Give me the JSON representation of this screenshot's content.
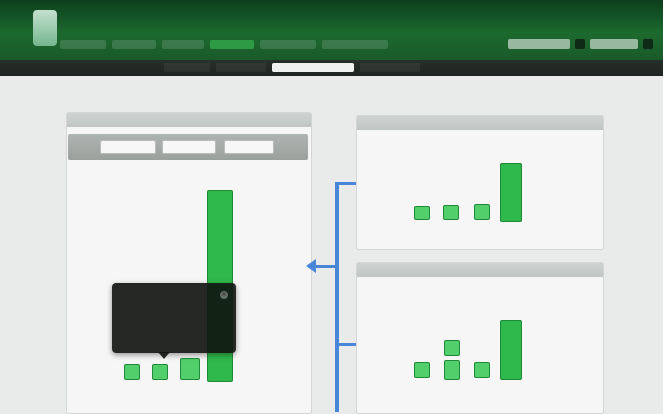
{
  "header": {
    "app_title": "",
    "nav_items": [
      "",
      "",
      "",
      "",
      "",
      ""
    ],
    "active_nav_index": 3,
    "tools": [
      "",
      "",
      ""
    ]
  },
  "subnav": {
    "tabs": [
      "",
      "",
      "",
      ""
    ],
    "active_index": 2
  },
  "left_panel": {
    "title": "",
    "filters": [
      "",
      "",
      ""
    ],
    "y_axis_labels": [
      "",
      "",
      "",
      ""
    ],
    "x_caption": ""
  },
  "tooltip": {
    "title": "",
    "left_value": "",
    "right_value": "",
    "close_icon": "close-icon"
  },
  "right_panel_top": {
    "title": "",
    "y_axis_labels": [
      "",
      "",
      "",
      ""
    ],
    "x_caption": ""
  },
  "right_panel_bottom": {
    "title": "",
    "y_axis_labels": [
      "",
      "",
      "",
      ""
    ],
    "x_caption": ""
  },
  "colors": {
    "header_green": "#1c6a2f",
    "bar_green": "#2fb84b",
    "connector_blue": "#4a86d8",
    "tooltip_bg": "#0f1210"
  }
}
